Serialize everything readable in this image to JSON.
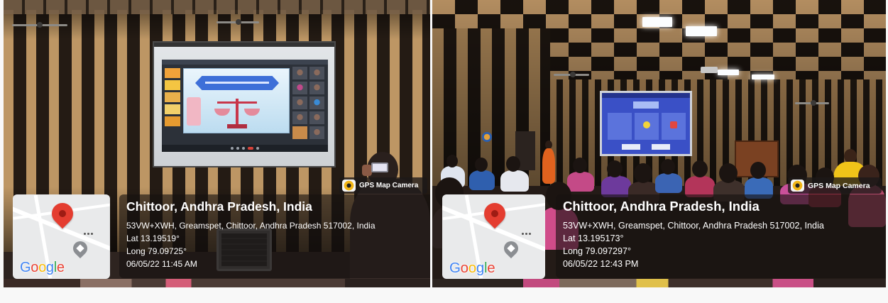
{
  "photos": [
    {
      "badge": {
        "label": "GPS Map Camera",
        "icon": "gps-map-camera-app-icon"
      },
      "location_title": "Chittoor, Andhra Pradesh, India",
      "address": "53VW+XWH, Greamspet, Chittoor, Andhra Pradesh 517002, India",
      "latitude": "Lat 13.19519°",
      "longitude": "Long 79.09725°",
      "datetime": "06/05/22 11:45 AM",
      "map": {
        "logo": "Google",
        "pin_icon": "map-pin-icon",
        "place_icon": "graduation-cap-icon",
        "menu_icon": "more-dots-icon"
      }
    },
    {
      "badge": {
        "label": "GPS Map Camera",
        "icon": "gps-map-camera-app-icon"
      },
      "location_title": "Chittoor, Andhra Pradesh, India",
      "address": "53VW+XWH, Greamspet, Chittoor, Andhra Pradesh 517002, India",
      "latitude": "Lat 13.195173°",
      "longitude": "Long 79.097297°",
      "datetime": "06/05/22 12:43 PM",
      "map": {
        "logo": "Google",
        "pin_icon": "map-pin-icon",
        "place_icon": "graduation-cap-icon",
        "menu_icon": "more-dots-icon"
      }
    }
  ],
  "colors": {
    "pin": "#e43d30",
    "overlay": "rgba(22,18,16,0.62)",
    "badge_bg": "rgba(28,24,24,0.78)",
    "map_bg": "#e9eaeb",
    "text": "#ffffff",
    "wall_tan": "#bd9664",
    "wall_dark": "#241b14",
    "google_letters": [
      "#4285F4",
      "#EA4335",
      "#FBBC05",
      "#4285F4",
      "#34A853",
      "#EA4335"
    ]
  }
}
